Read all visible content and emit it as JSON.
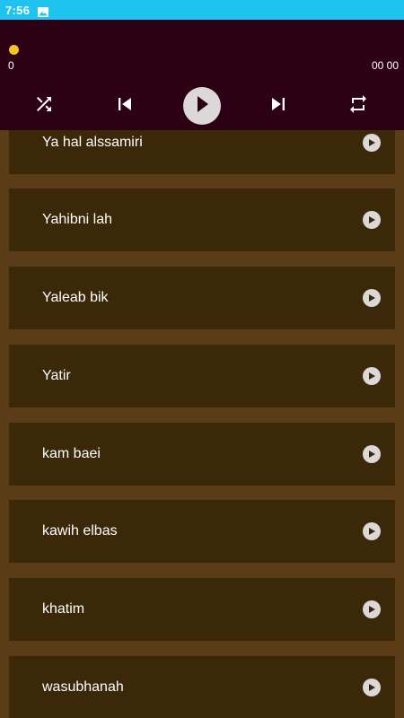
{
  "status_bar": {
    "time": "7:56",
    "icons": [
      "image-icon"
    ],
    "color": "#1ec3f0"
  },
  "player": {
    "background": "#2d0114",
    "current_time": "0",
    "total_time": "00 00",
    "progress": 0,
    "thumb_color": "#f7c31e",
    "controls": [
      "shuffle-icon",
      "skip-previous-icon",
      "play-icon",
      "skip-next-icon",
      "repeat-icon"
    ]
  },
  "songs": [
    {
      "title": "Ya hal alssamiri"
    },
    {
      "title": "Yahibni lah"
    },
    {
      "title": "Yaleab bik"
    },
    {
      "title": "Yatir"
    },
    {
      "title": "kam baei"
    },
    {
      "title": "kawih elbas"
    },
    {
      "title": "khatim"
    },
    {
      "title": "wasubhanah"
    }
  ],
  "colors": {
    "list_background": "#5a3d17",
    "item_background": "#3a2808",
    "text": "#ffffff"
  }
}
